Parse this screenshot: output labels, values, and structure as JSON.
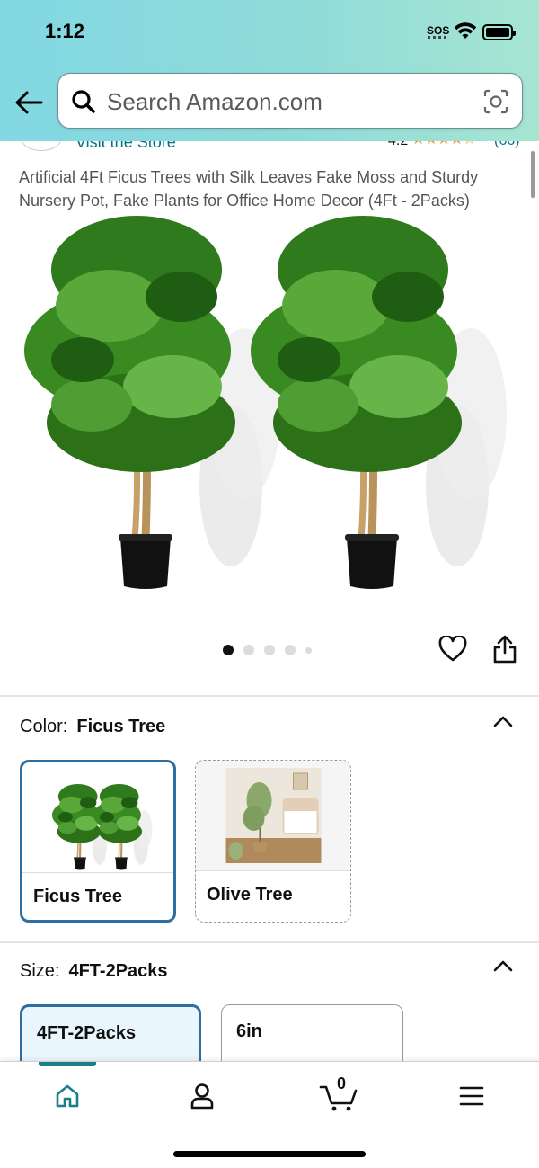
{
  "status_bar": {
    "time": "1:12",
    "sos": "SOS"
  },
  "search": {
    "placeholder": "Search Amazon.com"
  },
  "store": {
    "link_text": "Visit the Store",
    "rating": "4.2",
    "review_count": "(66)",
    "stars": 4
  },
  "product": {
    "title": "Artificial 4Ft Ficus Trees with Silk Leaves Fake Moss and Sturdy Nursery Pot, Fake Plants for Office Home Decor (4Ft - 2Packs)",
    "image_count": 5,
    "active_image": 1
  },
  "color": {
    "label": "Color:",
    "selected": "Ficus Tree",
    "options": [
      {
        "label": "Ficus Tree",
        "selected": true
      },
      {
        "label": "Olive Tree",
        "selected": false
      }
    ]
  },
  "size": {
    "label": "Size:",
    "selected": "4FT-2Packs",
    "options": [
      {
        "label": "4FT-2Packs",
        "selected": true
      },
      {
        "label": "6in",
        "selected": false
      }
    ]
  },
  "tabbar": {
    "items": [
      {
        "icon": "home-icon",
        "active": true
      },
      {
        "icon": "account-icon",
        "active": false
      },
      {
        "icon": "cart-icon",
        "active": false
      },
      {
        "icon": "menu-icon",
        "active": false
      }
    ],
    "cart_count": "0"
  },
  "colors": {
    "accent": "#007185",
    "selected_border": "#2f6fa0",
    "star": "#f7931e",
    "tab_active": "#1b7f8a"
  }
}
